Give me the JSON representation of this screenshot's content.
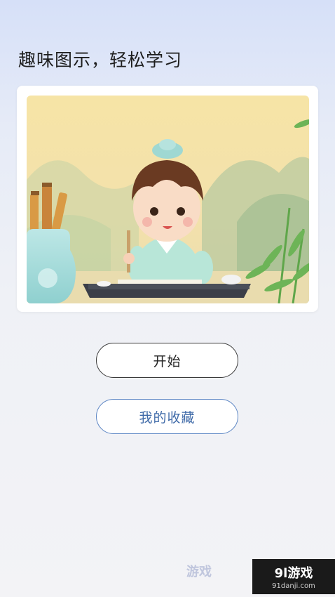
{
  "headline": "趣味图示，轻松学习",
  "buttons": {
    "start_label": "开始",
    "favorites_label": "我的收藏"
  },
  "watermark": {
    "left_text": "游戏",
    "brand": "9l游戏",
    "url": "91danji.com"
  },
  "colors": {
    "start_border": "#3a3a3a",
    "favorites_border": "#5c86c4",
    "favorites_text": "#3f6aa8"
  }
}
